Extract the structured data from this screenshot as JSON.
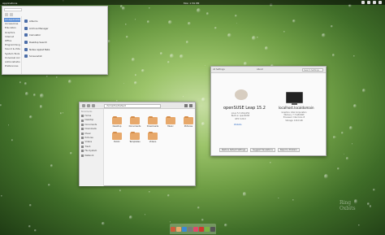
{
  "panel": {
    "applications_label": "Applications",
    "clock": "Mon 1:59 PM",
    "tray_icons": [
      "network-icon",
      "volume-icon",
      "battery-icon",
      "power-icon"
    ]
  },
  "app_menu": {
    "categories": [
      "All Applications",
      "Accessories",
      "Education",
      "Graphics",
      "Internet",
      "Office",
      "Programming",
      "Sound & Video",
      "System Tools",
      "Universal Access",
      "Administration",
      "Preferences"
    ],
    "apps": [
      "Albums",
      "Archive Manager",
      "Calculator",
      "Desktop Search",
      "Notes Applet Beta",
      "Screenshot"
    ]
  },
  "file_manager": {
    "path": "/home/Tux/Default",
    "sidebar_head": "Bookmarks",
    "sidebar": [
      "Home",
      "Desktop",
      "Documents",
      "Downloads",
      "Music",
      "Pictures",
      "Videos",
      "Trash",
      "File System",
      "Network"
    ],
    "folders": [
      "Desktop",
      "Documents",
      "Downloads",
      "Music",
      "Pictures",
      "Public",
      "Templates",
      "Videos"
    ]
  },
  "about": {
    "back_label": "All Settings",
    "tab_label": "About",
    "search_placeholder": "Search Settings",
    "os_name": "openSUSE Leap 15.2",
    "os_info": [
      "Linux 5.3.18-lp152",
      "Built on openSUSE",
      "GTK 3.24.0"
    ],
    "os_link": "Website",
    "hostname": "localhost.localdomain",
    "hw_info": [
      "Graphics: Intel Corporation",
      "Memory: 7.7 GiB RAM",
      "Processor: Intel Core i5",
      "Storage: 120.0 GB"
    ],
    "buttons": [
      "Restore Default Settings",
      "Suggest Translations",
      "Report a Problem"
    ]
  },
  "dock": {
    "colors": [
      "#cf5a3a",
      "#e7a86a",
      "#3b8ad6",
      "#7a7a7a",
      "#e14a6c",
      "#d0392e",
      "#7cb342",
      "#555555"
    ]
  },
  "watermark": [
    "Ring",
    "Oxbits"
  ]
}
